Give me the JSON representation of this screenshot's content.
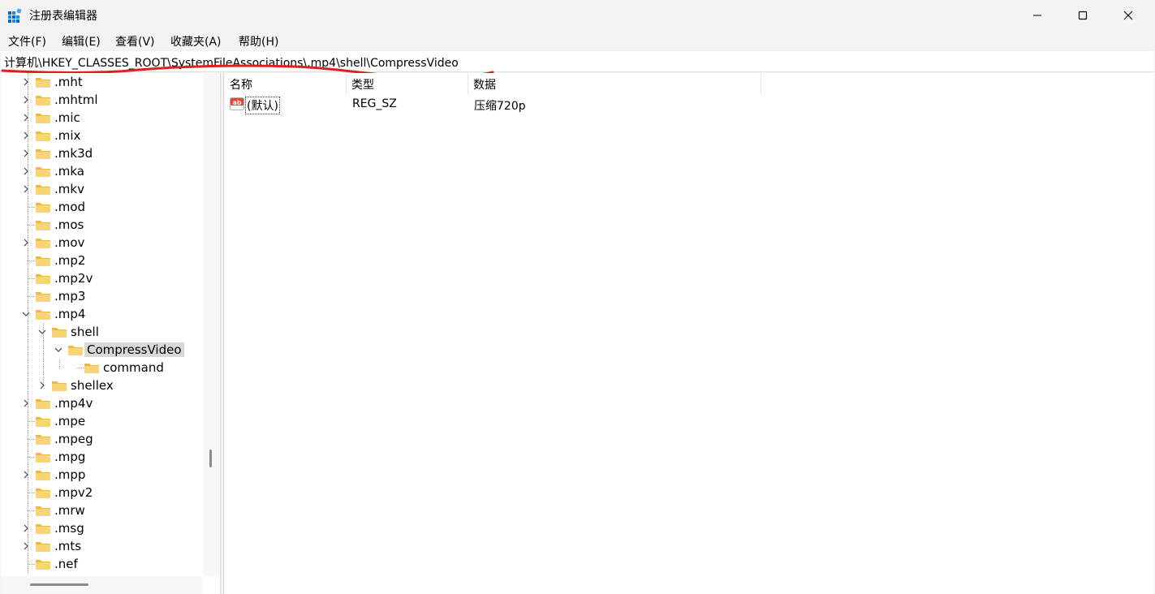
{
  "window": {
    "title": "注册表编辑器",
    "accent_color": "#0078d4",
    "underline_color": "#e0201f"
  },
  "menu": [
    {
      "label": "文件(F)"
    },
    {
      "label": "编辑(E)"
    },
    {
      "label": "查看(V)"
    },
    {
      "label": "收藏夹(A)"
    },
    {
      "label": "帮助(H)"
    }
  ],
  "address": {
    "path": "计算机\\HKEY_CLASSES_ROOT\\SystemFileAssociations\\.mp4\\shell\\CompressVideo"
  },
  "tree": {
    "items": [
      {
        "label": ".mht",
        "expander": "collapsed"
      },
      {
        "label": ".mhtml",
        "expander": "collapsed"
      },
      {
        "label": ".mic",
        "expander": "collapsed"
      },
      {
        "label": ".mix",
        "expander": "collapsed"
      },
      {
        "label": ".mk3d",
        "expander": "collapsed"
      },
      {
        "label": ".mka",
        "expander": "collapsed"
      },
      {
        "label": ".mkv",
        "expander": "collapsed"
      },
      {
        "label": ".mod",
        "expander": "none"
      },
      {
        "label": ".mos",
        "expander": "none"
      },
      {
        "label": ".mov",
        "expander": "collapsed"
      },
      {
        "label": ".mp2",
        "expander": "none"
      },
      {
        "label": ".mp2v",
        "expander": "none"
      },
      {
        "label": ".mp3",
        "expander": "none"
      },
      {
        "label": ".mp4",
        "expander": "expanded"
      },
      {
        "label": "shell",
        "expander": "expanded"
      },
      {
        "label": "CompressVideo",
        "expander": "expanded",
        "selected": true
      },
      {
        "label": "command",
        "expander": "none"
      },
      {
        "label": "shellex",
        "expander": "collapsed"
      },
      {
        "label": ".mp4v",
        "expander": "collapsed"
      },
      {
        "label": ".mpe",
        "expander": "none"
      },
      {
        "label": ".mpeg",
        "expander": "none"
      },
      {
        "label": ".mpg",
        "expander": "none"
      },
      {
        "label": ".mpp",
        "expander": "collapsed"
      },
      {
        "label": ".mpv2",
        "expander": "none"
      },
      {
        "label": ".mrw",
        "expander": "none"
      },
      {
        "label": ".msg",
        "expander": "collapsed"
      },
      {
        "label": ".mts",
        "expander": "collapsed"
      },
      {
        "label": ".nef",
        "expander": "none"
      }
    ]
  },
  "list": {
    "columns": [
      "名称",
      "类型",
      "数据"
    ],
    "rows": [
      {
        "icon": "string-value-icon",
        "name": "(默认)",
        "type": "REG_SZ",
        "data": "压缩720p"
      }
    ]
  }
}
